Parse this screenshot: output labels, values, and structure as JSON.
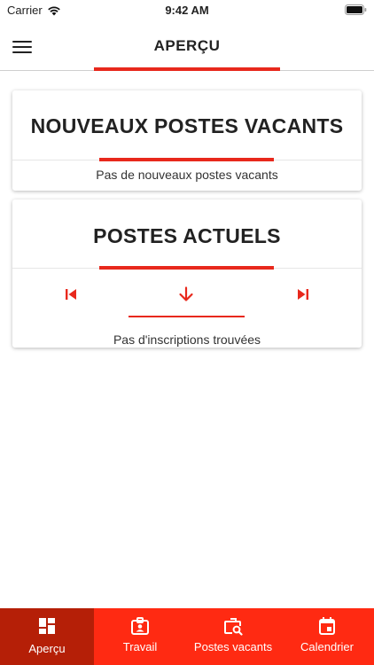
{
  "status_bar": {
    "carrier": "Carrier",
    "time": "9:42 AM"
  },
  "header": {
    "title": "APERÇU"
  },
  "cards": {
    "new_vacancies": {
      "title": "NOUVEAUX POSTES VACANTS",
      "message": "Pas de nouveaux postes vacants"
    },
    "current_jobs": {
      "title": "POSTES ACTUELS",
      "message": "Pas d'inscriptions trouvées"
    }
  },
  "tabs": [
    {
      "label": "Aperçu",
      "icon": "dashboard-icon",
      "active": true
    },
    {
      "label": "Travail",
      "icon": "badge-icon",
      "active": false
    },
    {
      "label": "Postes vacants",
      "icon": "job-search-icon",
      "active": false
    },
    {
      "label": "Calendrier",
      "icon": "calendar-icon",
      "active": false
    }
  ],
  "colors": {
    "accent": "#e8281c",
    "tab_bar": "#ff2a12",
    "tab_active": "#b51f07"
  }
}
